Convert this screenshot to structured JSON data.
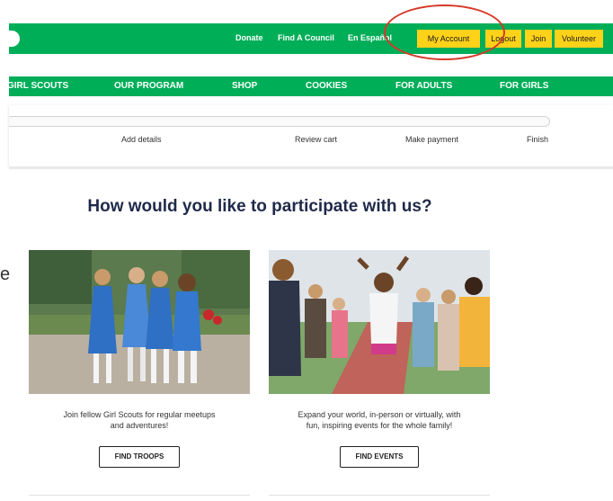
{
  "header": {
    "utility_links": [
      "Donate",
      "Find A Council",
      "En Español"
    ],
    "buttons": [
      "My Account",
      "Logout",
      "Join",
      "Volunteer"
    ]
  },
  "nav": {
    "items": [
      "GIRL SCOUTS",
      "OUR PROGRAM",
      "SHOP",
      "COOKIES",
      "FOR ADULTS",
      "FOR GIRLS"
    ]
  },
  "steps": [
    "Add details",
    "Review cart",
    "Make payment",
    "Finish"
  ],
  "main": {
    "heading": "How would you like to participate with us?",
    "stray_char": "e",
    "cards": [
      {
        "desc_line1": "Join fellow Girl Scouts for regular meetups",
        "desc_line2": "and adventures!",
        "button": "FIND TROOPS",
        "image": "troop-girls-photo"
      },
      {
        "desc_line1": "Expand your world, in-person or virtually, with",
        "desc_line2": "fun, inspiring events for the whole family!",
        "button": "FIND EVENTS",
        "image": "event-girls-photo"
      }
    ]
  },
  "colors": {
    "brand_green": "#00ae58",
    "button_yellow": "#ffd21a",
    "heading_navy": "#1f2a4a",
    "annotation_red": "#d63a2a"
  }
}
